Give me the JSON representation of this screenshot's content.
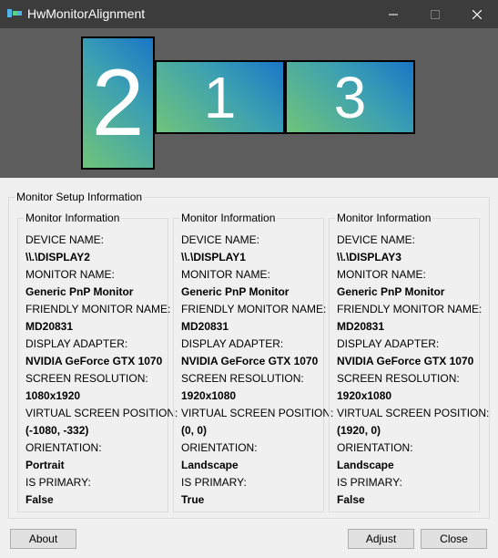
{
  "window": {
    "title": "HwMonitorAlignment",
    "minimize_glyph": "—",
    "maximize_glyph": "☐",
    "close_glyph": "✕"
  },
  "preview": {
    "monitors": [
      {
        "number": "2",
        "orientation": "Portrait"
      },
      {
        "number": "1",
        "orientation": "Landscape"
      },
      {
        "number": "3",
        "orientation": "Landscape"
      }
    ]
  },
  "setup": {
    "title": "Monitor Setup Information",
    "label_texts": {
      "group": "Monitor Information",
      "device_name": "DEVICE NAME:",
      "monitor_name": "MONITOR NAME:",
      "friendly_name": "FRIENDLY MONITOR NAME:",
      "display_adapter": "DISPLAY ADAPTER:",
      "screen_resolution": "SCREEN RESOLUTION:",
      "virtual_position": "VIRTUAL SCREEN POSITION:",
      "orientation": "ORIENTATION:",
      "is_primary": "IS PRIMARY:"
    },
    "monitors": [
      {
        "device_name": "\\\\.\\DISPLAY2",
        "monitor_name": "Generic PnP Monitor",
        "friendly_name": "MD20831",
        "display_adapter": "NVIDIA GeForce GTX 1070",
        "screen_resolution": "1080x1920",
        "virtual_position": "(-1080, -332)",
        "orientation": "Portrait",
        "is_primary": "False"
      },
      {
        "device_name": "\\\\.\\DISPLAY1",
        "monitor_name": "Generic PnP Monitor",
        "friendly_name": "MD20831",
        "display_adapter": "NVIDIA GeForce GTX 1070",
        "screen_resolution": "1920x1080",
        "virtual_position": "(0, 0)",
        "orientation": "Landscape",
        "is_primary": "True"
      },
      {
        "device_name": "\\\\.\\DISPLAY3",
        "monitor_name": "Generic PnP Monitor",
        "friendly_name": "MD20831",
        "display_adapter": "NVIDIA GeForce GTX 1070",
        "screen_resolution": "1920x1080",
        "virtual_position": "(1920, 0)",
        "orientation": "Landscape",
        "is_primary": "False"
      }
    ]
  },
  "buttons": {
    "about": "About",
    "adjust": "Adjust",
    "close": "Close"
  },
  "colors": {
    "titlebar": "#3c3c3c",
    "preview_bg": "#5d5d5d",
    "monitor_gradient_start": "#1a76c7",
    "monitor_gradient_end": "#6fc47a",
    "dialog_bg": "#f0f0f0"
  }
}
